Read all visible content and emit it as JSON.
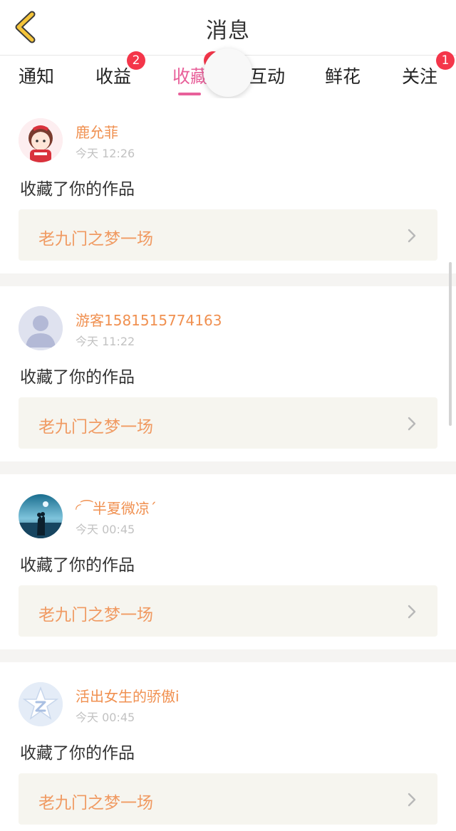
{
  "header": {
    "title": "消息",
    "back_icon": "chevron-left-icon"
  },
  "tabs": [
    {
      "label": "通知",
      "badge": "",
      "active": false
    },
    {
      "label": "收益",
      "badge": "2",
      "active": false
    },
    {
      "label": "收藏",
      "badge": "",
      "active": true
    },
    {
      "label": "互动",
      "badge": "",
      "active": false
    },
    {
      "label": "鲜花",
      "badge": "",
      "active": false
    },
    {
      "label": "关注",
      "badge": "1",
      "active": false
    }
  ],
  "colors": {
    "accent": "#e8609a",
    "badge": "#f4364a",
    "username": "#f09050",
    "work_title": "#f09a62"
  },
  "messages": [
    {
      "username": "鹿允菲",
      "time": "今天 12:26",
      "action": "收藏了你的作品",
      "work": "老九门之梦一场",
      "avatar": "cartoon-girl-avatar"
    },
    {
      "username": "游客1581515774163",
      "time": "今天 11:22",
      "action": "收藏了你的作品",
      "work": "老九门之梦一场",
      "avatar": "default-guest-avatar"
    },
    {
      "username": "◜⁀半夏微凉´",
      "time": "今天 00:45",
      "action": "收藏了你的作品",
      "work": "老九门之梦一场",
      "avatar": "couple-sea-avatar"
    },
    {
      "username": "活出女生的骄傲i",
      "time": "今天 00:45",
      "action": "收藏了你的作品",
      "work": "老九门之梦一场",
      "avatar": "qzone-star-avatar"
    }
  ]
}
